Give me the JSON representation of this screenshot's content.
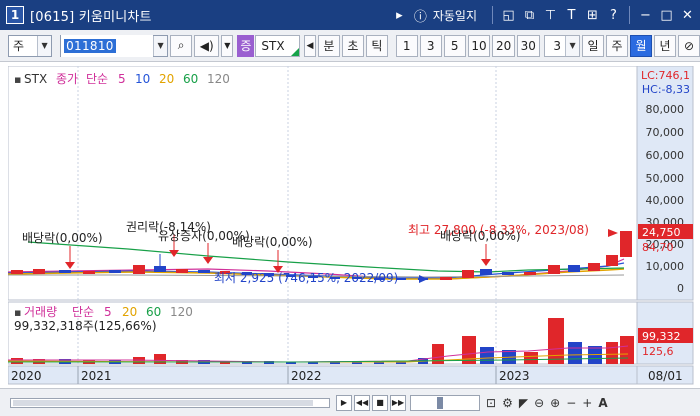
{
  "window": {
    "number": "1",
    "title": "[0615] 키움미니차트",
    "auto_save_label": "자동일지"
  },
  "toolbar": {
    "market": "주",
    "code": "011810",
    "grade_badge": "증",
    "stock_name": "STX",
    "periods": [
      "분",
      "초",
      "틱"
    ],
    "intervals": [
      "1",
      "3",
      "5",
      "10",
      "20",
      "30"
    ],
    "interval_selected": "3",
    "timeframes": [
      "일",
      "주",
      "월",
      "년"
    ],
    "timeframe_selected": "월"
  },
  "price_legend": {
    "name": "STX",
    "label": "종가",
    "ma_type": "단순",
    "ma_periods": [
      "5",
      "10",
      "20",
      "60",
      "120"
    ],
    "ma_colors": [
      "#d0309a",
      "#2554d8",
      "#e2a300",
      "#18a048",
      "#888888"
    ]
  },
  "volume_legend": {
    "name": "거래량",
    "ma_type": "단순",
    "ma_periods": [
      "5",
      "20",
      "60",
      "120"
    ],
    "value_text": "99,332,318주(125,66%)"
  },
  "right_top": {
    "lc": "LC:746,1",
    "hc": "HC:-8,33"
  },
  "y_axis": [
    "80,000",
    "70,000",
    "60,000",
    "50,000",
    "40,000",
    "30,000",
    "20,000",
    "10,000",
    "0"
  ],
  "price_tags": {
    "current": "24,750",
    "ma": "84,70"
  },
  "volume_tags": {
    "current": "99,332",
    "ratio": "125,6"
  },
  "x_axis": [
    "2020",
    "2021",
    "2022",
    "2023",
    "08/01"
  ],
  "annotations": {
    "dividend1": "배당락(0,00%)",
    "rights": "권리락(-8,14%)",
    "capital": "유상증자(0,00%)",
    "dividend2": "배당락(0,00%)",
    "low": "최저 2,925 (746,15%, 2022/09)",
    "high": "최고 27,800 (-8,33%, 2023/08)",
    "dividend3": "배당락(0,00%)"
  },
  "colors": {
    "up": "#e0262a",
    "down": "#2244c8",
    "title_bar": "#1a3f82",
    "selected": "#2b6be0"
  }
}
